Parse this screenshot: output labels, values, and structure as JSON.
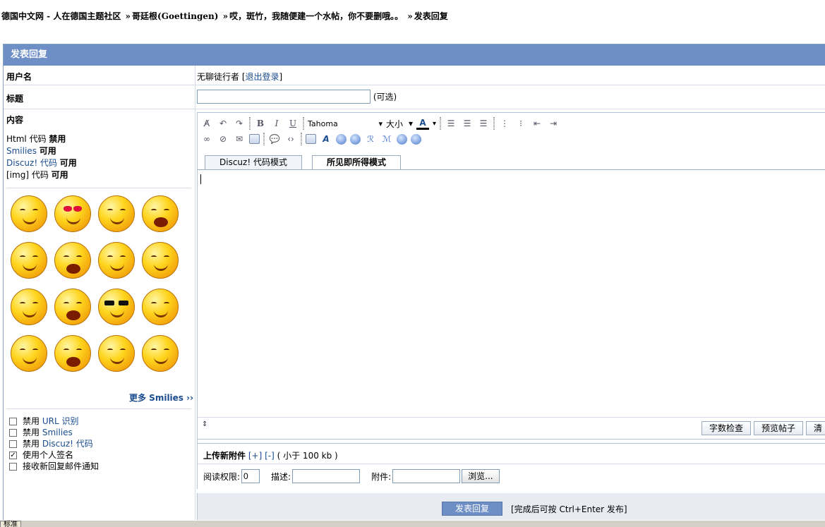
{
  "breadcrumb": {
    "items": [
      "德国中文网 - 人在德国主题社区",
      "哥廷根(Goettingen)",
      "哎，斑竹，我随便建一个水帖，你不要删哦。。",
      "发表回复"
    ],
    "separator": "»"
  },
  "panel": {
    "title": "发表回复"
  },
  "form": {
    "username_label": "用户名",
    "username_value": "无聊徒行者",
    "logout_text": "退出登录",
    "subject_label": "标题",
    "subject_value": "",
    "subject_optional": "(可选)",
    "content_label": "内容"
  },
  "codes": [
    {
      "name": "Html 代码",
      "status": "禁用",
      "linked": false
    },
    {
      "name": "Smilies",
      "status": "可用",
      "linked": true
    },
    {
      "name": "Discuz! 代码",
      "status": "可用",
      "linked": true
    },
    {
      "name": "[img] 代码",
      "status": "可用",
      "linked": false
    }
  ],
  "smilies": {
    "more_label": "更多 Smilies ››"
  },
  "options": [
    {
      "label_prefix": "禁用",
      "label_link": "URL 识别",
      "checked": false
    },
    {
      "label_prefix": "禁用",
      "label_link": "Smilies",
      "checked": false
    },
    {
      "label_prefix": "禁用",
      "label_link": "Discuz! 代码",
      "checked": false
    },
    {
      "label_prefix": "使用个人签名",
      "label_link": "",
      "checked": true
    },
    {
      "label_prefix": "接收新回复邮件通知",
      "label_link": "",
      "checked": false
    }
  ],
  "editor": {
    "font_name": "Tahoma",
    "size_label": "大小",
    "tab_code": "Discuz! 代码模式",
    "tab_wysiwyg": "所见即所得模式",
    "active_tab": "tab_wysiwyg",
    "content": ""
  },
  "editor_footer": {
    "word_check": "字数检查",
    "preview": "预览帖子",
    "clear": "清"
  },
  "attachment": {
    "title": "上传新附件",
    "add": "[+]",
    "remove": "[-]",
    "limit": "( 小于 100 kb )",
    "permission_label": "阅读权限:",
    "permission_value": "0",
    "desc_label": "描述:",
    "file_label": "附件:",
    "browse": "浏览..."
  },
  "submit": {
    "button": "发表回复",
    "tip": "[完成后可按 Ctrl+Enter 发布]"
  },
  "taskbar": {
    "ime_label": "标准"
  }
}
